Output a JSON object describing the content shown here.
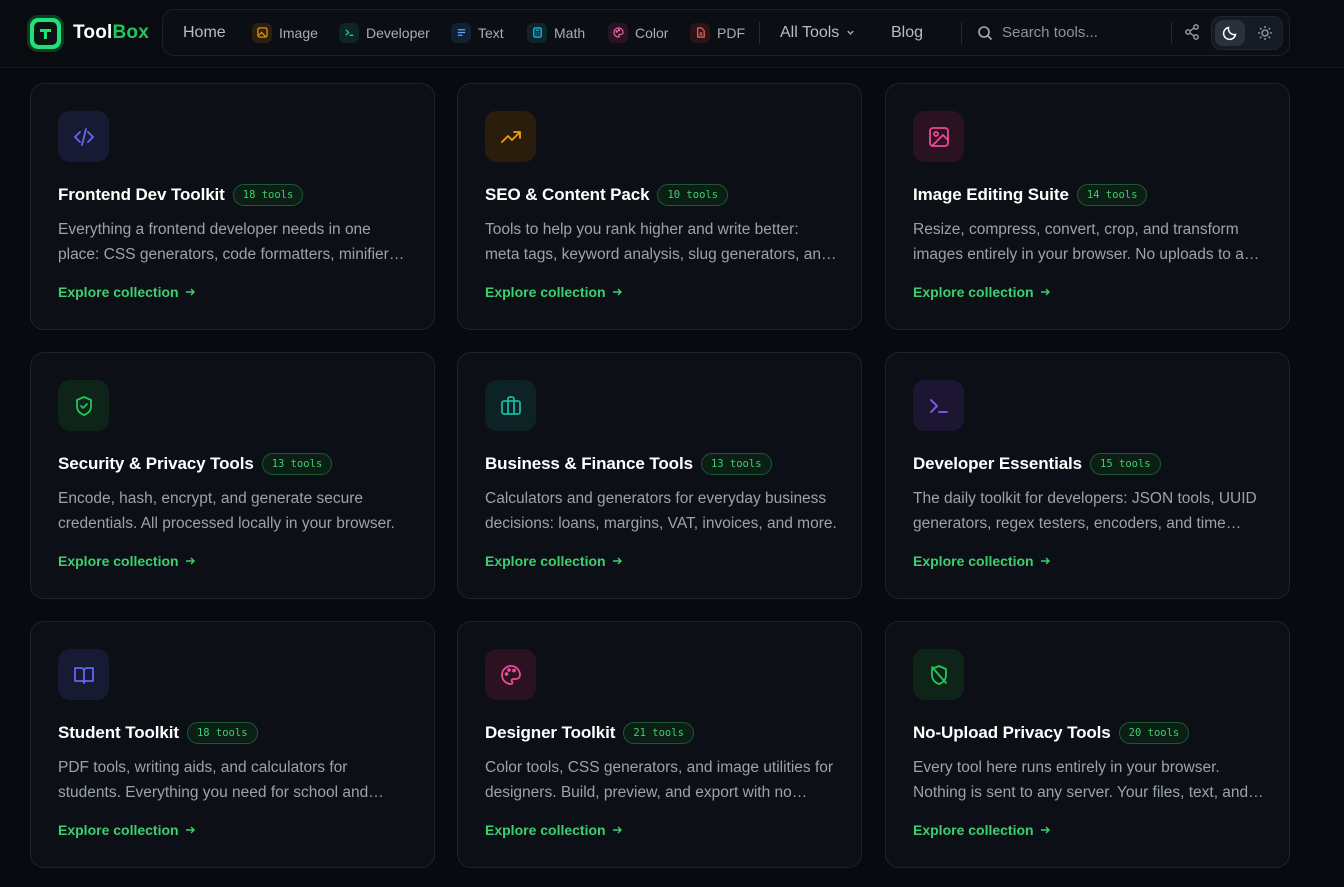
{
  "brand": {
    "name_part1": "Tool",
    "name_part2": "Box",
    "accent": "#22c55e"
  },
  "nav": {
    "home": "Home",
    "categories": [
      {
        "label": "Image",
        "icon": "image-icon",
        "color": "#f59e0b"
      },
      {
        "label": "Developer",
        "icon": "terminal-icon",
        "color": "#2dd4bf"
      },
      {
        "label": "Text",
        "icon": "text-lines-icon",
        "color": "#60a5fa"
      },
      {
        "label": "Math",
        "icon": "calculator-icon",
        "color": "#22d3ee"
      },
      {
        "label": "Color",
        "icon": "palette-icon",
        "color": "#f472b6"
      },
      {
        "label": "PDF",
        "icon": "pdf-icon",
        "color": "#f87171"
      }
    ],
    "all_tools": "All Tools",
    "blog": "Blog",
    "search_placeholder": "Search tools..."
  },
  "collections": [
    {
      "title": "Frontend Dev Toolkit",
      "badge": "18 tools",
      "icon": "code-icon",
      "color": "#6366f1",
      "bg": "#171a33",
      "desc": "Everything a frontend developer needs in one place: CSS generators, code formatters, minifiers, and more.",
      "link": "Explore collection"
    },
    {
      "title": "SEO & Content Pack",
      "badge": "10 tools",
      "icon": "trending-up-icon",
      "color": "#f59e0b",
      "bg": "#2a1d0c",
      "desc": "Tools to help you rank higher and write better: meta tags, keyword analysis, slug generators, and more.",
      "link": "Explore collection"
    },
    {
      "title": "Image Editing Suite",
      "badge": "14 tools",
      "icon": "image-icon",
      "color": "#ec4899",
      "bg": "#2a1220",
      "desc": "Resize, compress, convert, crop, and transform images entirely in your browser. No uploads to any server.",
      "link": "Explore collection"
    },
    {
      "title": "Security & Privacy Tools",
      "badge": "13 tools",
      "icon": "shield-check-icon",
      "color": "#22c55e",
      "bg": "#0e2418",
      "desc": "Encode, hash, encrypt, and generate secure credentials. All processed locally in your browser.",
      "link": "Explore collection"
    },
    {
      "title": "Business & Finance Tools",
      "badge": "13 tools",
      "icon": "briefcase-icon",
      "color": "#14b8a6",
      "bg": "#0d2224",
      "desc": "Calculators and generators for everyday business decisions: loans, margins, VAT, invoices, and more.",
      "link": "Explore collection"
    },
    {
      "title": "Developer Essentials",
      "badge": "15 tools",
      "icon": "terminal-icon",
      "color": "#8b5cf6",
      "bg": "#1c1633",
      "desc": "The daily toolkit for developers: JSON tools, UUID generators, regex testers, encoders, and time utilities.",
      "link": "Explore collection"
    },
    {
      "title": "Student Toolkit",
      "badge": "18 tools",
      "icon": "book-open-icon",
      "color": "#6366f1",
      "bg": "#171a33",
      "desc": "PDF tools, writing aids, and calculators for students. Everything you need for school and homework.",
      "link": "Explore collection"
    },
    {
      "title": "Designer Toolkit",
      "badge": "21 tools",
      "icon": "palette-icon",
      "color": "#ec4899",
      "bg": "#2a1220",
      "desc": "Color tools, CSS generators, and image utilities for designers. Build, preview, and export with no friction.",
      "link": "Explore collection"
    },
    {
      "title": "No-Upload Privacy Tools",
      "badge": "20 tools",
      "icon": "shield-off-icon",
      "color": "#22c55e",
      "bg": "#0e2418",
      "desc": "Every tool here runs entirely in your browser. Nothing is sent to any server. Your files, text, and data stay private.",
      "link": "Explore collection"
    }
  ]
}
